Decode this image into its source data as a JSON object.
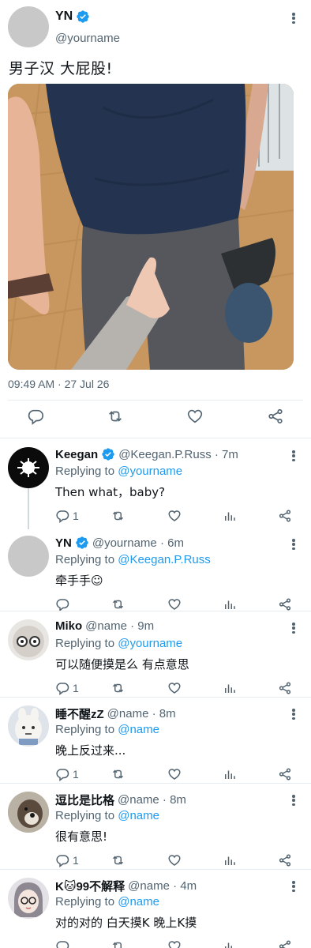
{
  "main": {
    "name": "YN",
    "handle": "@yourname",
    "text": "男子汉 大屁股!",
    "time": "09:49 AM · 27 Jul 26"
  },
  "replies": [
    {
      "name": "Keegan",
      "handle": "@Keegan.P.Russ · 7m",
      "replying_label": "Replying to",
      "replying_to": "@yourname",
      "text": "Then what，baby?",
      "reply_count": "1",
      "verified": true
    },
    {
      "name": "YN",
      "handle": "@yourname · 6m",
      "replying_label": "Replying to",
      "replying_to": "@Keegan.P.Russ",
      "text": "牵手手☺",
      "reply_count": "",
      "verified": true
    },
    {
      "name": "Miko",
      "handle": "@name · 9m",
      "replying_label": "Replying to",
      "replying_to": "@yourname",
      "text": "可以随便摸是么 有点意思",
      "reply_count": "1",
      "verified": false
    },
    {
      "name": "睡不醒zZ",
      "handle": "@name · 8m",
      "replying_label": "Replying to",
      "replying_to": "@name",
      "text": "晚上反过来...",
      "reply_count": "1",
      "verified": false
    },
    {
      "name": "逗比是比格",
      "handle": "@name · 8m",
      "replying_label": "Replying to",
      "replying_to": "@name",
      "text": "很有意思!",
      "reply_count": "1",
      "verified": false
    },
    {
      "name": "K🐱99不解释",
      "handle": "@name · 4m",
      "replying_label": "Replying to",
      "replying_to": "@name",
      "text": "对的对的 白天摸K 晚上K摸",
      "reply_count": "",
      "verified": false
    }
  ],
  "icons": {
    "verified": "verified-badge-icon",
    "reply": "reply-icon",
    "retweet": "retweet-icon",
    "like": "like-icon",
    "views": "views-icon",
    "share": "share-icon",
    "more": "more-icon"
  },
  "colors": {
    "link": "#1d9bf0",
    "secondary_text": "#536471",
    "verified": "#1d9bf0",
    "divider": "#e6ecf0"
  }
}
